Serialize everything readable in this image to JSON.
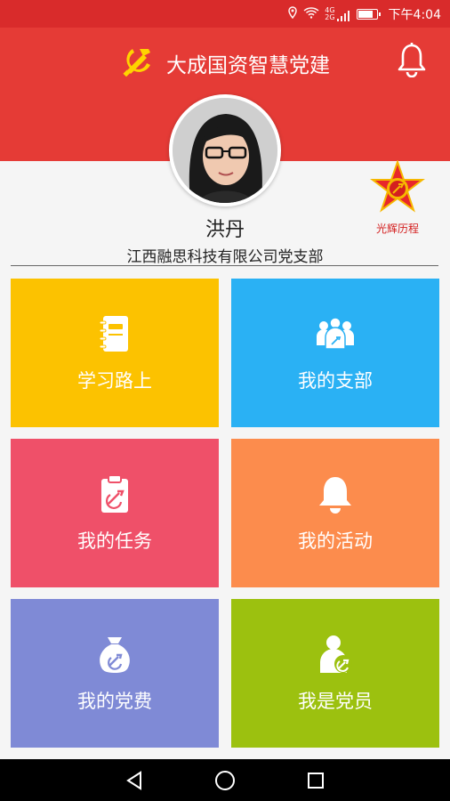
{
  "status_bar": {
    "time": "下午4:04",
    "network": "4G",
    "network2": "2G"
  },
  "header": {
    "title": "大成国资智慧党建"
  },
  "profile": {
    "name": "洪丹",
    "organization": "江西融思科技有限公司党支部"
  },
  "badge": {
    "label": "光辉历程"
  },
  "tiles": [
    {
      "label": "学习路上",
      "color": "#fcc200",
      "icon": "notebook-icon"
    },
    {
      "label": "我的支部",
      "color": "#2ab1f4",
      "icon": "members-group-icon"
    },
    {
      "label": "我的任务",
      "color": "#ef5069",
      "icon": "task-clipboard-icon"
    },
    {
      "label": "我的活动",
      "color": "#fc8c4d",
      "icon": "bell-icon"
    },
    {
      "label": "我的党费",
      "color": "#7f8ad6",
      "icon": "money-bag-icon"
    },
    {
      "label": "我是党员",
      "color": "#9cc10f",
      "icon": "party-member-icon"
    }
  ],
  "colors": {
    "header": "#e53b36",
    "status_bar": "#d92b2b"
  }
}
